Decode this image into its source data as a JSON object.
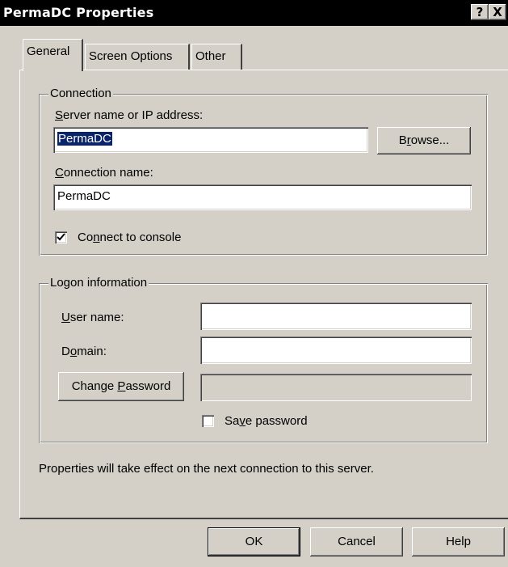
{
  "window": {
    "title": "PermaDC Properties",
    "help_glyph": "?",
    "close_glyph": "X"
  },
  "tabs": [
    {
      "label": "General",
      "active": true
    },
    {
      "label": "Screen Options",
      "active": false
    },
    {
      "label": "Other",
      "active": false
    }
  ],
  "connection": {
    "group_label": "Connection",
    "server_label_accel": "S",
    "server_label_rest": "erver name or IP address:",
    "server_value": "PermaDC",
    "browse_pre": "B",
    "browse_accel": "r",
    "browse_post": "owse...",
    "connection_name_accel": "C",
    "connection_name_rest": "onnection name:",
    "connection_name_value": "PermaDC",
    "console_pre": "Co",
    "console_accel": "n",
    "console_post": "nect to console",
    "console_checked": true
  },
  "logon": {
    "group_label": "Logon information",
    "user_accel": "U",
    "user_rest": "ser name:",
    "user_value": "",
    "domain_pre": "D",
    "domain_accel": "o",
    "domain_post": "main:",
    "domain_value": "",
    "change_pw_pre": "Change ",
    "change_pw_accel": "P",
    "change_pw_post": "assword",
    "password_value": "",
    "save_pw_pre": "Sa",
    "save_pw_accel": "v",
    "save_pw_post": "e password",
    "save_pw_checked": false
  },
  "note": "Properties will take effect on the next connection to this server.",
  "buttons": {
    "ok": "OK",
    "cancel": "Cancel",
    "help": "Help"
  }
}
